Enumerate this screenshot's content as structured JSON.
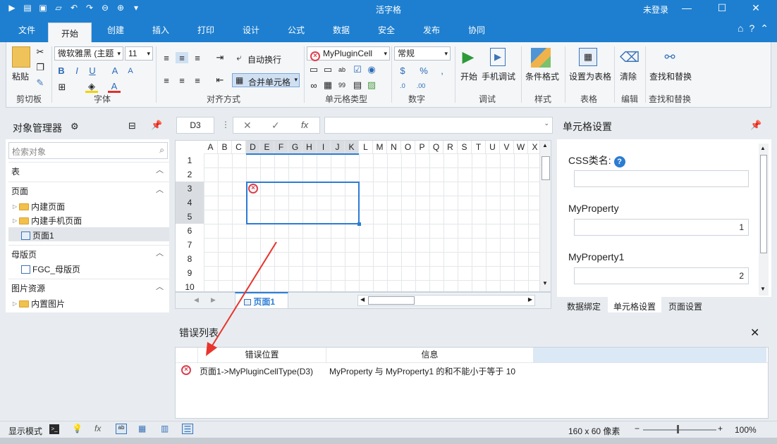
{
  "titlebar": {
    "title": "活字格",
    "login": "未登录",
    "min": "—",
    "max": "☐",
    "close": "✕"
  },
  "menu": {
    "tabs": [
      "文件",
      "开始",
      "创建",
      "插入",
      "打印",
      "设计",
      "公式",
      "数据",
      "安全",
      "发布",
      "协同"
    ],
    "active_index": 1
  },
  "ribbon": {
    "clipboard": {
      "paste": "粘贴",
      "group": "剪切板"
    },
    "font": {
      "family": "微软雅黑 (主题",
      "size": "11",
      "group": "字体"
    },
    "align": {
      "wrap": "自动换行",
      "merge": "合并单元格",
      "group": "对齐方式"
    },
    "celltype": {
      "selected": "MyPluginCell",
      "group": "单元格类型"
    },
    "number": {
      "format": "常规",
      "group": "数字"
    },
    "debug": {
      "start": "开始",
      "mobile": "手机调试",
      "group": "调试"
    },
    "style": {
      "cond": "条件格式",
      "group": "样式"
    },
    "table": {
      "set": "设置为表格",
      "group": "表格"
    },
    "edit": {
      "clear": "清除",
      "group": "编辑"
    },
    "find": {
      "label": "查找和替换",
      "group": "查找和替换"
    }
  },
  "object_manager": {
    "title": "对象管理器",
    "search_placeholder": "检索对象",
    "sections": {
      "tables": "表",
      "pages": "页面",
      "page_items": [
        "内建页面",
        "内建手机页面",
        "页面1"
      ],
      "master": "母版页",
      "master_items": [
        "FGC_母版页"
      ],
      "images": "图片资源",
      "image_items": [
        "内置图片"
      ]
    }
  },
  "formula_bar": {
    "cell_ref": "D3",
    "fx": "fx"
  },
  "grid": {
    "columns": [
      "A",
      "B",
      "C",
      "D",
      "E",
      "F",
      "G",
      "H",
      "I",
      "J",
      "K",
      "L",
      "M",
      "N",
      "O",
      "P",
      "Q",
      "R",
      "S",
      "T",
      "U",
      "V",
      "W",
      "X"
    ],
    "rows": [
      "1",
      "2",
      "3",
      "4",
      "5",
      "6",
      "7",
      "8",
      "9",
      "10"
    ]
  },
  "sheet_tabs": {
    "active": "页面1"
  },
  "cell_settings": {
    "title": "单元格设置",
    "css_label": "CSS类名:",
    "css_value": "",
    "prop1_label": "MyProperty",
    "prop1_value": "1",
    "prop2_label": "MyProperty1",
    "prop2_value": "2",
    "tabs": [
      "数据绑定",
      "单元格设置",
      "页面设置"
    ]
  },
  "error_list": {
    "title": "错误列表",
    "columns": [
      "错误位置",
      "信息"
    ],
    "rows": [
      {
        "location": "页面1->MyPluginCellType(D3)",
        "message": "MyProperty 与 MyProperty1 的和不能小于等于 10"
      }
    ]
  },
  "statusbar": {
    "mode": "显示模式",
    "size": "160 x 60 像素",
    "zoom": "100%"
  },
  "colors": {
    "brand": "#1e7fd0",
    "selection": "#2b7cd3",
    "error": "#d9414e",
    "arrow": "#e8342c"
  }
}
